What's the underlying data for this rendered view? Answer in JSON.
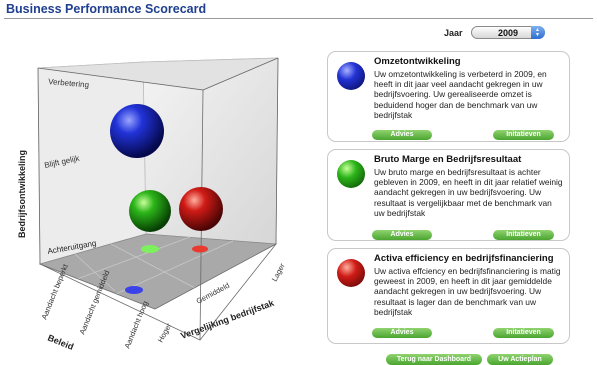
{
  "page": {
    "title": "Business Performance Scorecard"
  },
  "year_selector": {
    "label": "Jaar",
    "value": "2009"
  },
  "cube_chart": {
    "axis_vertical": "Bedrijfsontwikkeling",
    "vertical_levels": [
      "Verbetering",
      "Blijft gelijk",
      "Achteruitgang"
    ],
    "axis_policy": "Beleid",
    "policy_levels": [
      "Aandacht beperkt",
      "Aandacht gemiddeld",
      "Aandacht hoog"
    ],
    "axis_benchmark": "Vergelijking bedrijfstak",
    "benchmark_levels": [
      "Hoger",
      "Gemiddeld",
      "Lager"
    ]
  },
  "cards": [
    {
      "title": "Omzetontwikkeling",
      "text": "Uw omzetontwikkeling is verbeterd in 2009, en heeft in dit jaar veel aandacht gekregen in uw bedrijfsvoering. Uw gerealiseerde omzet is beduidend hoger dan de benchmark van uw bedrijfstak",
      "color": "#1c2bd6",
      "advice_label": "Advies",
      "initiatives_label": "Initatieven"
    },
    {
      "title": "Bruto Marge en Bedrijfsresultaat",
      "text": "Uw bruto marge en bedrijfsresultaat is achter gebleven in 2009, en heeft in dit jaar relatief weinig aandacht gekregen in uw bedrijfsvoering. Uw resultaat is vergelijkbaar met de benchmark van uw bedrijfstak",
      "color": "#2fbd1e",
      "advice_label": "Advies",
      "initiatives_label": "Initatieven"
    },
    {
      "title": "Activa efficiency en bedrijfsfinanciering",
      "text": "Uw activa effciency en bedrijfsfinanciering is matig geweest in 2009, en heeft in dit jaar gemiddelde aandacht gekregen in uw bedrijfsvoering. Uw resultaat is lager dan de benchmark van uw bedrijfstak",
      "color": "#d0201c",
      "advice_label": "Advies",
      "initiatives_label": "Initatieven"
    }
  ],
  "footer": {
    "dashboard_label": "Terug naar Dashboard",
    "action_plan_label": "Uw Actieplan"
  }
}
